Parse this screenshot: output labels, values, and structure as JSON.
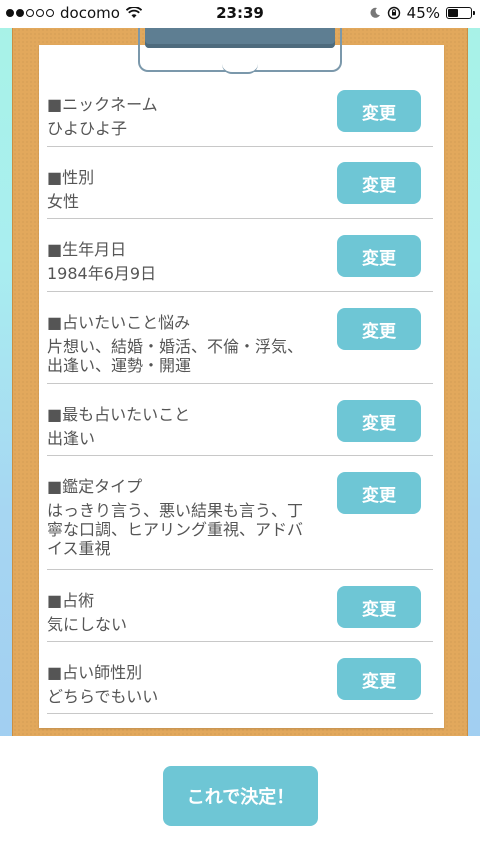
{
  "status_bar": {
    "carrier": "docomo",
    "time": "23:39",
    "battery_percent": "45%",
    "battery_level": 0.45,
    "signal_bars_filled": 2,
    "signal_bars_total": 5
  },
  "profile_items": [
    {
      "label": "■ニックネーム",
      "value": "ひよひよ子",
      "button": "変更"
    },
    {
      "label": "■性別",
      "value": "女性",
      "button": "変更"
    },
    {
      "label": "■生年月日",
      "value": "1984年6月9日",
      "button": "変更"
    },
    {
      "label": "■占いたいこと悩み",
      "value": "片想い、結婚・婚活、不倫・浮気、出逢い、運勢・開運",
      "button": "変更"
    },
    {
      "label": "■最も占いたいこと",
      "value": "出逢い",
      "button": "変更"
    },
    {
      "label": "■鑑定タイプ",
      "value": "はっきり言う、悪い結果も言う、丁寧な口調、ヒアリング重視、アドバイス重視",
      "button": "変更"
    },
    {
      "label": "■占術",
      "value": "気にしない",
      "button": "変更"
    },
    {
      "label": "■占い師性別",
      "value": "どちらでもいい",
      "button": "変更"
    }
  ],
  "confirm_button": "これで決定！",
  "colors": {
    "accent": "#6ec6d5",
    "clipboard": "#e2a85c",
    "clip": "#5e7e92"
  }
}
